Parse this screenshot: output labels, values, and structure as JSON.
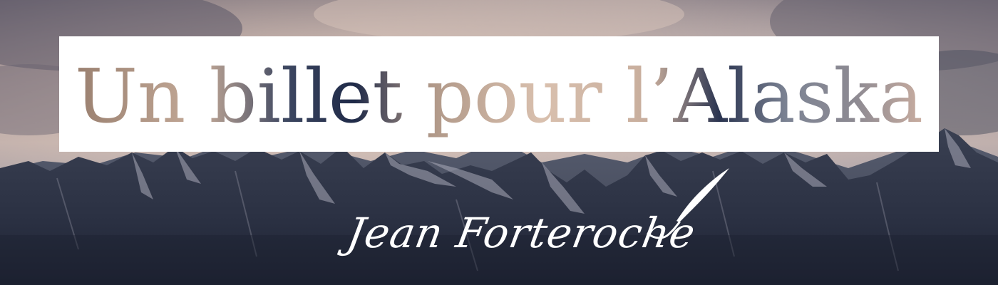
{
  "banner": {
    "title": "Un billet pour l’Alaska",
    "author": "Jean Forteroche",
    "icons": {
      "author_ornament": "quill-pen-icon"
    },
    "colors": {
      "sky_top": "#6a6070",
      "sky_glow": "#d9c3b5",
      "cloud_dark": "#4c5060",
      "mountain": "#2e3446",
      "mountain_dark": "#1f2434",
      "snow": "#a9aab8",
      "title_box": "#ffffff",
      "author_text": "#ffffff"
    }
  }
}
